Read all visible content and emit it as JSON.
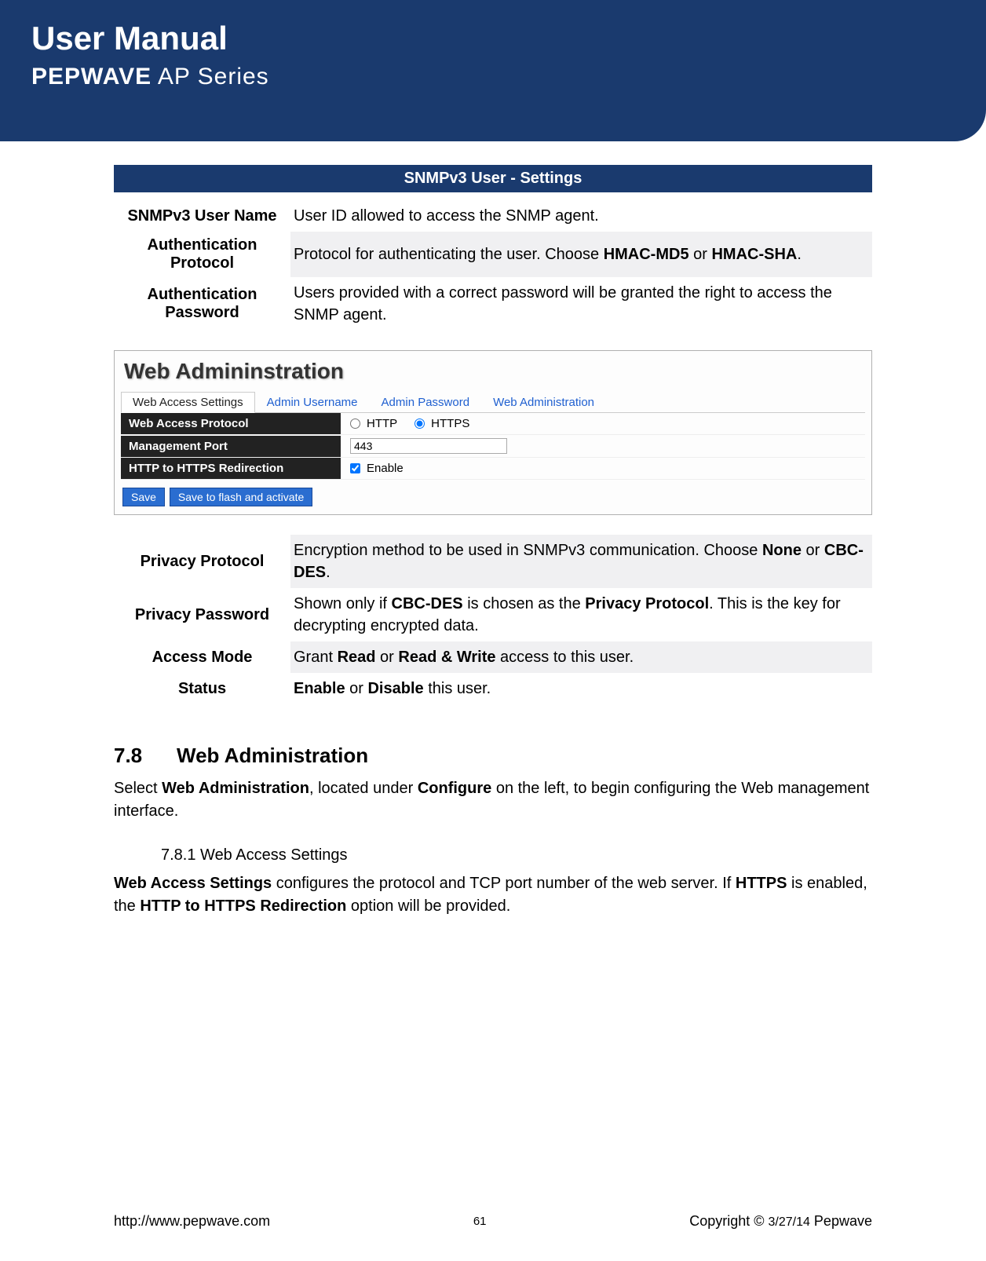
{
  "header": {
    "title": "User Manual",
    "brand_bold": "PEPWAVE",
    "brand_thin": " AP Series"
  },
  "settings_header": "SNMPv3 User - Settings",
  "rows_top": [
    {
      "label": "SNMPv3 User Name",
      "desc": "User ID allowed to access the SNMP agent.",
      "bg": false
    },
    {
      "label": "Authentication Protocol",
      "desc_html": "Protocol for authenticating the user. Choose <b>HMAC-MD5</b> or <b>HMAC-SHA</b>.",
      "bg": true
    },
    {
      "label": "Authentication Password",
      "desc": "Users provided with a correct password will be granted the right to access the SNMP agent.",
      "bg": false
    }
  ],
  "screenshot": {
    "title": "Web Admininstration",
    "tabs": [
      "Web Access Settings",
      "Admin Username",
      "Admin Password",
      "Web Administration"
    ],
    "active_tab": 0,
    "rows": [
      {
        "label": "Web Access Protocol",
        "type": "radio",
        "options": [
          "HTTP",
          "HTTPS"
        ],
        "selected": 1
      },
      {
        "label": "Management Port",
        "type": "text",
        "value": "443"
      },
      {
        "label": "HTTP to HTTPS Redirection",
        "type": "checkbox",
        "checked": true,
        "cblabel": "Enable"
      }
    ],
    "buttons": [
      "Save",
      "Save to flash and activate"
    ]
  },
  "rows_bottom": [
    {
      "label": "Privacy Protocol",
      "desc_html": "Encryption method to be used in SNMPv3 communication. Choose <b>None</b> or <b>CBC-DES</b>.",
      "bg": true
    },
    {
      "label": "Privacy Password",
      "desc_html": "Shown only if <b>CBC-DES</b> is chosen as the <b>Privacy Protocol</b>. This is the key for decrypting encrypted data.",
      "bg": false
    },
    {
      "label": "Access Mode",
      "desc_html": "Grant <b>Read</b> or <b>Read & Write</b> access to this user.",
      "bg": true
    },
    {
      "label": "Status",
      "desc_html": "<b>Enable</b> or <b>Disable</b> this user.",
      "bg": false
    }
  ],
  "section": {
    "num": "7.8",
    "title": "Web Administration",
    "body_html": "Select <b>Web Administration</b>, located under <b>Configure</b> on the left, to begin configuring the Web management interface.",
    "sub_num": "7.8.1",
    "sub_title": "Web Access Settings",
    "sub_body_html": "<b>Web Access Settings</b> configures the protocol and TCP port number of the web server. If <b>HTTPS</b> is enabled, the <b>HTTP to HTTPS Redirection</b> option will be provided."
  },
  "footer": {
    "left": "http://www.pepwave.com",
    "page": "61",
    "right_html": "Copyright © <span style='font-size:16px'>3/27/14</span> Pepwave"
  }
}
